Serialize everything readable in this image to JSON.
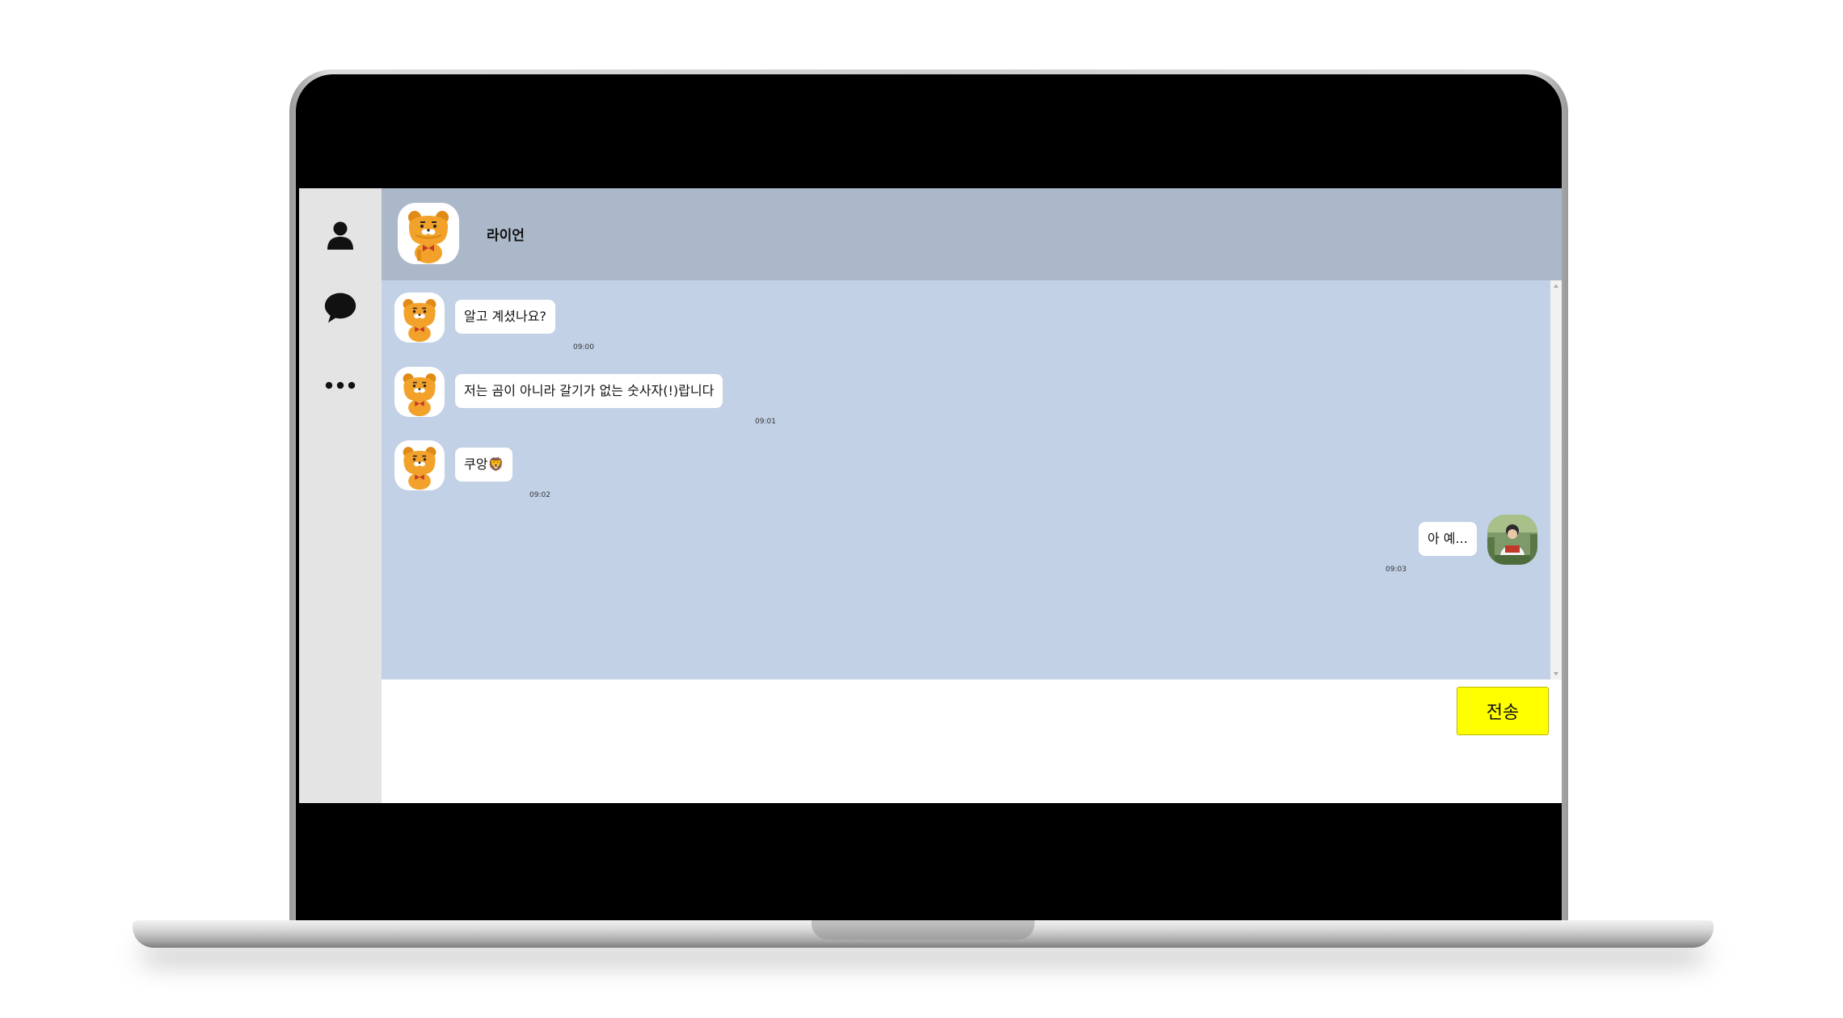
{
  "chat": {
    "partner_name": "라이언",
    "messages": [
      {
        "sender": "라이언",
        "text": "알고 계셨나요?",
        "time": "09:00",
        "mine": false
      },
      {
        "sender": "라이언",
        "text": "저는 곰이 아니라 갈기가 없는 숫사자(!)랍니다",
        "time": "09:01",
        "mine": false
      },
      {
        "sender": "라이언",
        "text": "쿠앙",
        "emoji": "🦁",
        "time": "09:02",
        "mine": false
      },
      {
        "sender": "me",
        "text": "아 예...",
        "time": "09:03",
        "mine": true
      }
    ]
  },
  "input": {
    "placeholder": "",
    "send_label": "전송"
  },
  "sidebar": {
    "icons": [
      "friends-icon",
      "chat-bubble-icon",
      "more-icon"
    ]
  },
  "colors": {
    "header": "#aab8ca",
    "chat_bg": "#c2d1e6",
    "send": "#ffff00",
    "sidebar": "#e4e4e4"
  }
}
